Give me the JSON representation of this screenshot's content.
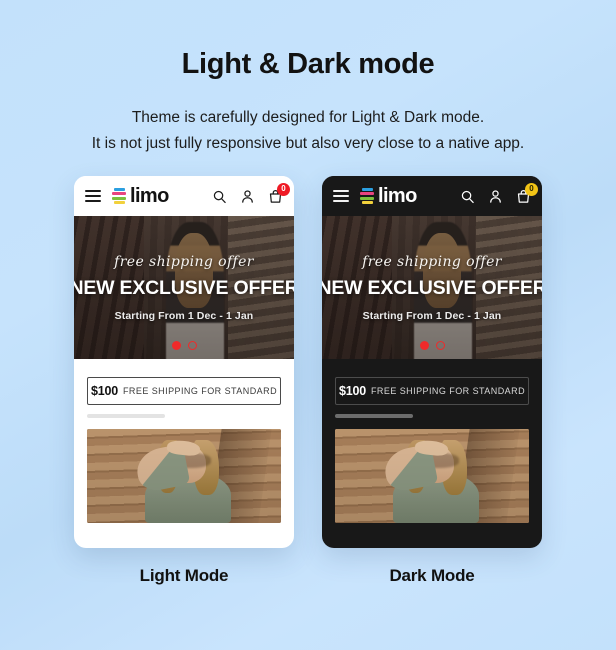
{
  "header": {
    "title": "Light & Dark mode",
    "subtitle_line1": "Theme is carefully designed for Light & Dark mode.",
    "subtitle_line2": "It is not just fully responsive but also very close to a native app."
  },
  "colors": {
    "background_top": "#c3e1fb",
    "background_mid": "#bcdcf8",
    "light_surface": "#ffffff",
    "dark_surface": "#181818",
    "badge_light": "#ef1a25",
    "badge_dark": "#f2c416",
    "dot_active": "#ef2a2a",
    "logo_blue": "#2b9fe0",
    "logo_pink": "#e8447f",
    "logo_green": "#7cc03c",
    "logo_yellow": "#f2d13c"
  },
  "phones": [
    {
      "mode": "light",
      "caption": "Light Mode",
      "appbar": {
        "menu_icon": "hamburger-menu-icon",
        "logo_text": "limo",
        "search_icon": "search-icon",
        "account_icon": "user-account-icon",
        "cart_icon": "shopping-bag-icon",
        "cart_count": "0"
      },
      "hero": {
        "script_text": "free shipping offer",
        "title": "NEW EXCLUSIVE OFFER",
        "subtitle": "Starting From 1 Dec - 1 Jan",
        "dots_total": 2,
        "dot_active_index": 0
      },
      "promo": {
        "price": "$100",
        "text": "FREE SHIPPING FOR STANDARD"
      }
    },
    {
      "mode": "dark",
      "caption": "Dark Mode",
      "appbar": {
        "menu_icon": "hamburger-menu-icon",
        "logo_text": "limo",
        "search_icon": "search-icon",
        "account_icon": "user-account-icon",
        "cart_icon": "shopping-bag-icon",
        "cart_count": "0"
      },
      "hero": {
        "script_text": "free shipping offer",
        "title": "NEW EXCLUSIVE OFFER",
        "subtitle": "Starting From 1 Dec - 1 Jan",
        "dots_total": 2,
        "dot_active_index": 0
      },
      "promo": {
        "price": "$100",
        "text": "FREE SHIPPING FOR STANDARD"
      }
    }
  ]
}
